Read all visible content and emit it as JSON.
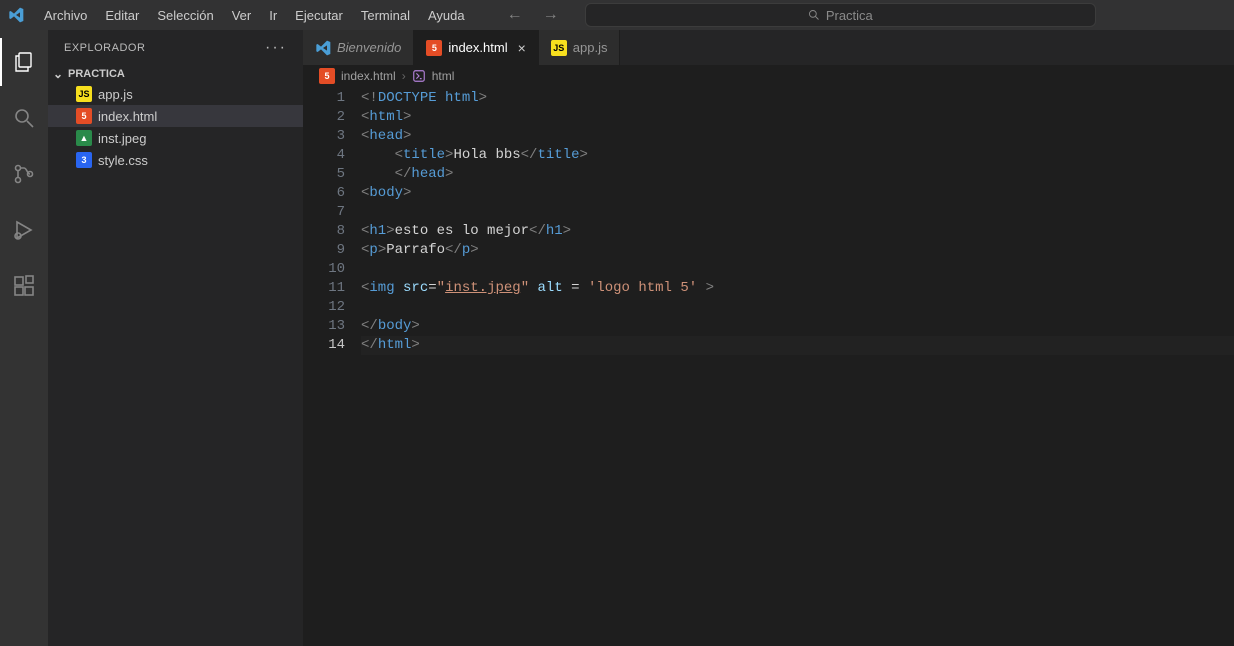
{
  "menubar": [
    "Archivo",
    "Editar",
    "Selección",
    "Ver",
    "Ir",
    "Ejecutar",
    "Terminal",
    "Ayuda"
  ],
  "search": {
    "placeholder": "Practica"
  },
  "sidebar": {
    "title": "EXPLORADOR",
    "folder": "PRACTICA",
    "files": [
      {
        "name": "app.js",
        "icon": "js",
        "label": "JS"
      },
      {
        "name": "index.html",
        "icon": "html",
        "label": "5",
        "selected": true
      },
      {
        "name": "inst.jpeg",
        "icon": "img",
        "label": "▲"
      },
      {
        "name": "style.css",
        "icon": "css",
        "label": "3"
      }
    ]
  },
  "tabs": [
    {
      "label": "Bienvenido",
      "icon": "vscode",
      "italic": true
    },
    {
      "label": "index.html",
      "icon": "html",
      "active": true,
      "close": true
    },
    {
      "label": "app.js",
      "icon": "js"
    }
  ],
  "breadcrumb": {
    "file": "index.html",
    "path": "html"
  },
  "editor": {
    "activeLine": 14,
    "lines": [
      {
        "n": 1,
        "tokens": [
          [
            "bracket",
            "<!"
          ],
          [
            "doctype",
            "DOCTYPE"
          ],
          [
            "text",
            " "
          ],
          [
            "tag",
            "html"
          ],
          [
            "bracket",
            ">"
          ]
        ]
      },
      {
        "n": 2,
        "tokens": [
          [
            "bracket",
            "<"
          ],
          [
            "tag",
            "html"
          ],
          [
            "bracket",
            ">"
          ]
        ]
      },
      {
        "n": 3,
        "tokens": [
          [
            "bracket",
            "<"
          ],
          [
            "tag",
            "head"
          ],
          [
            "bracket",
            ">"
          ]
        ]
      },
      {
        "n": 4,
        "indent": 1,
        "tokens": [
          [
            "bracket",
            "<"
          ],
          [
            "tag",
            "title"
          ],
          [
            "bracket",
            ">"
          ],
          [
            "text",
            "Hola bbs"
          ],
          [
            "bracket",
            "</"
          ],
          [
            "tag",
            "title"
          ],
          [
            "bracket",
            ">"
          ]
        ]
      },
      {
        "n": 5,
        "indent": 1,
        "tokens": [
          [
            "bracket",
            "</"
          ],
          [
            "tag",
            "head"
          ],
          [
            "bracket",
            ">"
          ]
        ]
      },
      {
        "n": 6,
        "tokens": [
          [
            "bracket",
            "<"
          ],
          [
            "tag",
            "body"
          ],
          [
            "bracket",
            ">"
          ]
        ]
      },
      {
        "n": 7,
        "tokens": []
      },
      {
        "n": 8,
        "tokens": [
          [
            "bracket",
            "<"
          ],
          [
            "tag",
            "h1"
          ],
          [
            "bracket",
            ">"
          ],
          [
            "text",
            "esto es lo mejor"
          ],
          [
            "bracket",
            "</"
          ],
          [
            "tag",
            "h1"
          ],
          [
            "bracket",
            ">"
          ]
        ]
      },
      {
        "n": 9,
        "tokens": [
          [
            "bracket",
            "<"
          ],
          [
            "tag",
            "p"
          ],
          [
            "bracket",
            ">"
          ],
          [
            "text",
            "Parrafo"
          ],
          [
            "bracket",
            "</"
          ],
          [
            "tag",
            "p"
          ],
          [
            "bracket",
            ">"
          ]
        ]
      },
      {
        "n": 10,
        "tokens": []
      },
      {
        "n": 11,
        "tokens": [
          [
            "bracket",
            "<"
          ],
          [
            "tag",
            "img"
          ],
          [
            "text",
            " "
          ],
          [
            "attr",
            "src"
          ],
          [
            "text",
            "="
          ],
          [
            "str",
            "\""
          ],
          [
            "str-u",
            "inst.jpeg"
          ],
          [
            "str",
            "\""
          ],
          [
            "text",
            " "
          ],
          [
            "attr",
            "alt"
          ],
          [
            "text",
            " = "
          ],
          [
            "str",
            "'logo html 5'"
          ],
          [
            "text",
            " "
          ],
          [
            "bracket",
            ">"
          ]
        ]
      },
      {
        "n": 12,
        "tokens": []
      },
      {
        "n": 13,
        "tokens": [
          [
            "bracket",
            "</"
          ],
          [
            "tag",
            "body"
          ],
          [
            "bracket",
            ">"
          ]
        ]
      },
      {
        "n": 14,
        "tokens": [
          [
            "bracket",
            "</"
          ],
          [
            "tag",
            "html"
          ],
          [
            "bracket",
            ">"
          ]
        ]
      }
    ]
  }
}
